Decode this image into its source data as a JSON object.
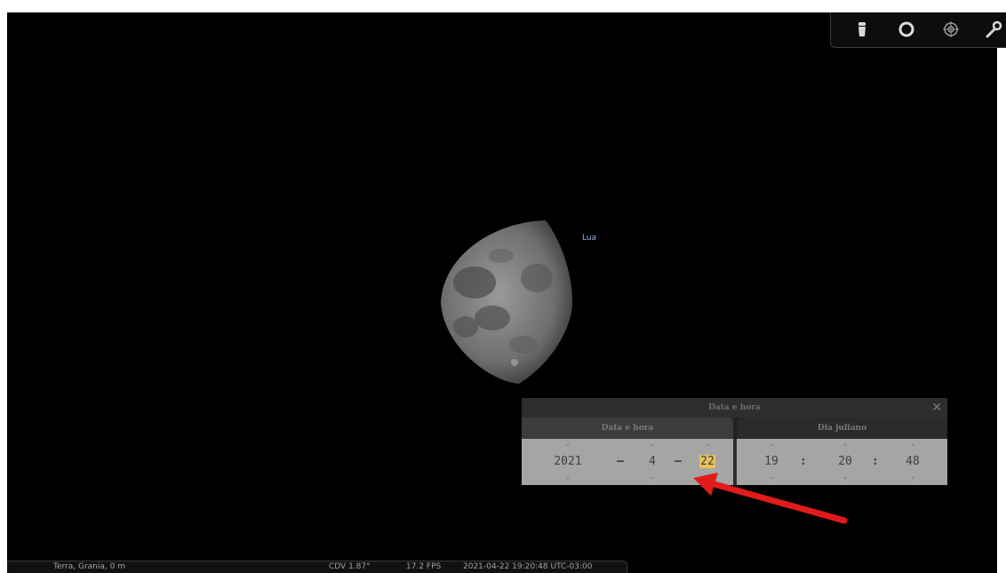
{
  "sky": {
    "object_label": "Lua"
  },
  "toolbar": {
    "buttons": [
      {
        "icon": "telescope-icon"
      },
      {
        "icon": "circle-icon"
      },
      {
        "icon": "target-icon"
      },
      {
        "icon": "wrench-icon"
      }
    ]
  },
  "dialog": {
    "title": "Data e hora",
    "close_glyph": "✕",
    "tabs": {
      "date": "Data e hora",
      "julian": "Dia juliano"
    },
    "date": {
      "year": "2021",
      "month": "4",
      "day": "22",
      "sep": "–"
    },
    "time": {
      "hour": "19",
      "minute": "20",
      "second": "48",
      "sep": ":"
    }
  },
  "statusbar": {
    "location": "Terra, Grania, 0 m",
    "fov": "CDV 1.87°",
    "fps": "17.2 FPS",
    "datetime": "2021-04-22 19:20:48 UTC-03:00"
  },
  "colors": {
    "highlight": "#e9c15c",
    "arrow": "#e11b1b",
    "label": "#9db7d8"
  }
}
